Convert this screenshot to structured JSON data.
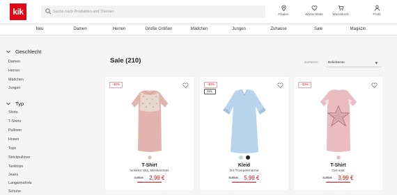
{
  "brand": {
    "logo_text": "kik",
    "color": "#e30613"
  },
  "search": {
    "placeholder": "Suche nach Produkten und Themen",
    "icon": "search-icon"
  },
  "header_icons": [
    {
      "label": "Filialen",
      "icon": "location-pin-icon"
    },
    {
      "label": "Wunschliste",
      "icon": "heart-icon"
    },
    {
      "label": "Warenkorb",
      "icon": "cart-icon"
    },
    {
      "label": "Profil",
      "icon": "user-icon"
    }
  ],
  "nav": [
    "Neu",
    "Damen",
    "Herren",
    "Große Größen",
    "Mädchen",
    "Jungen",
    "Zuhause",
    "Sale",
    "Magazin"
  ],
  "sidebar": {
    "geschlecht": {
      "title": "Geschlecht",
      "items": [
        "Damen",
        "Herren",
        "Mädchen",
        "Jungen"
      ]
    },
    "typ": {
      "title": "Typ",
      "items": [
        "Shirts",
        "T-Shirts",
        "Pullover",
        "Hosen",
        "Tops",
        "Strickpullover",
        "Tanktops",
        "Jeans",
        "Langarmshirts",
        "Schuhe"
      ]
    }
  },
  "main": {
    "title": "Sale (210)",
    "sort_label": "Sortieren:",
    "sort_value": "Beliebteste"
  },
  "products": [
    {
      "badge": "-40%",
      "size_badge": "",
      "name": "T-Shirt",
      "desc": "lockerer Sitz, Mesheinsatz",
      "old_price": "4,99 €",
      "price": "2,99 €",
      "swatches": [
        "#d9b8ac"
      ],
      "garment_color": "#e2b4ae",
      "accent": "#c9a89a"
    },
    {
      "badge": "-40%",
      "size_badge": "XXL",
      "name": "Kleid",
      "desc": "3/4-Trompetenarme",
      "old_price": "9,99 €",
      "price": "5,99 €",
      "swatches": [
        "#b9d6ee",
        "#222222"
      ],
      "garment_color": "#b8d4ec",
      "accent": "#a3c2dd"
    },
    {
      "badge": "-33%",
      "size_badge": "",
      "name": "T-Shirt",
      "desc": "Cut-outs",
      "old_price": "5,99 €",
      "price": "3,99 €",
      "swatches": [
        "#e8b9bd"
      ],
      "garment_color": "#e9bcc0",
      "accent": "#b07d88"
    }
  ]
}
